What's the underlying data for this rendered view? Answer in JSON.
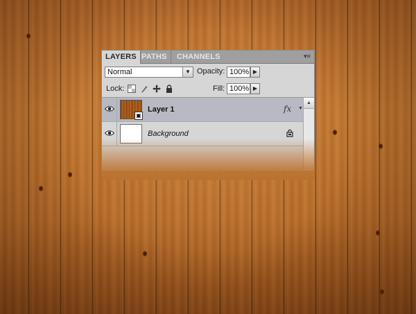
{
  "panel": {
    "tabs": [
      {
        "label": "LAYERS",
        "active": true
      },
      {
        "label": "PATHS",
        "active": false
      },
      {
        "label": "CHANNELS",
        "active": false
      }
    ],
    "menu_icon": "panel-menu-icon",
    "blend_mode": {
      "value": "Normal"
    },
    "opacity": {
      "label": "Opacity:",
      "value": "100%"
    },
    "lock": {
      "label": "Lock:",
      "icons": [
        "lock-transparent-pixels-icon",
        "lock-image-pixels-icon",
        "lock-position-icon",
        "lock-all-icon"
      ]
    },
    "fill": {
      "label": "Fill:",
      "value": "100%"
    },
    "layers": [
      {
        "name": "Layer 1",
        "visible": true,
        "selected": true,
        "smart_object": true,
        "effects": "fx"
      },
      {
        "name": "Background",
        "visible": true,
        "selected": false,
        "locked": true
      }
    ]
  },
  "colors": {
    "panel_bg": "#d6d6d6",
    "selected_layer": "#b9b9c4",
    "wood": "#b56a28"
  }
}
